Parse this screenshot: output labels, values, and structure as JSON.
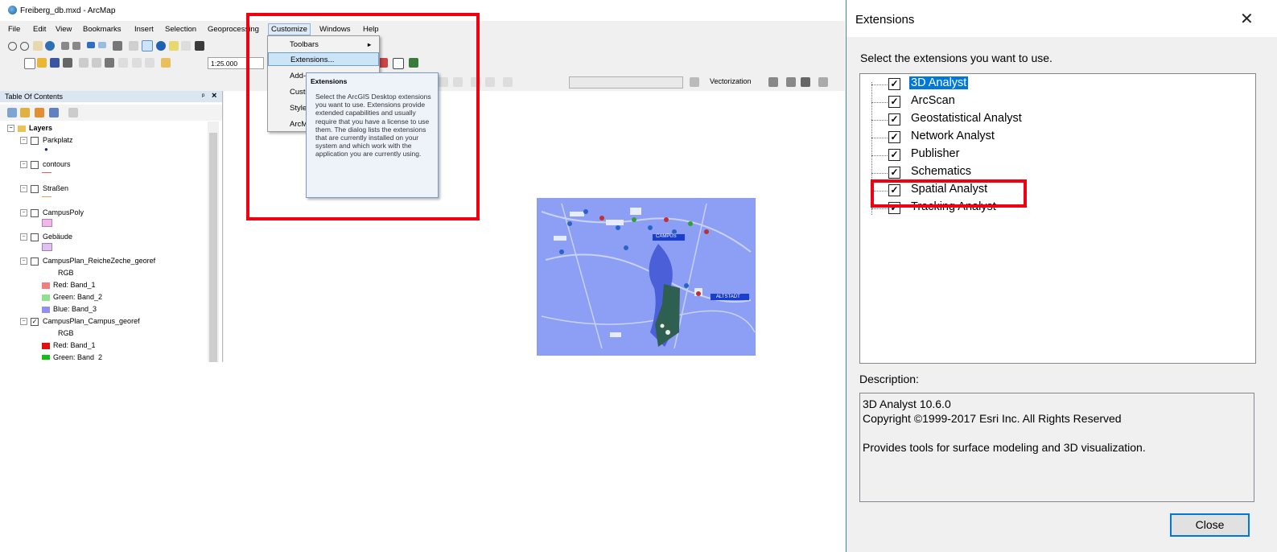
{
  "arcmap": {
    "title": "Freiberg_db.mxd - ArcMap",
    "menu": [
      "File",
      "Edit",
      "View",
      "Bookmarks",
      "Insert",
      "Selection",
      "Geoprocessing",
      "Customize",
      "Windows",
      "Help"
    ],
    "scale_value": "1:25.000",
    "vectorization_label": "Vectorization",
    "toc": {
      "title": "Table Of Contents",
      "layers_group": "Layers",
      "items": [
        {
          "name": "Parkplatz",
          "checked": false
        },
        {
          "name": "contours",
          "checked": false
        },
        {
          "name": "Straßen",
          "checked": false
        },
        {
          "name": "CampusPoly",
          "checked": false
        },
        {
          "name": "Gebäude",
          "checked": false
        },
        {
          "name": "CampusPlan_ReicheZeche_georef",
          "checked": false
        },
        {
          "name": "CampusPlan_Campus_georef",
          "checked": true
        }
      ],
      "rgb_label": "RGB",
      "band_rows_1": [
        "Red:   Band_1",
        "Green: Band_2",
        "Blue:  Band_3"
      ],
      "band_rows_2": [
        "Red:   Band_1",
        "Green: Band_2"
      ]
    },
    "customize_menu": {
      "items": [
        "Toolbars",
        "Extensions...",
        "Add-",
        "Custo",
        "Style",
        "ArcM"
      ]
    },
    "tooltip": {
      "title": "Extensions",
      "body": "Select the ArcGIS Desktop extensions you want to use. Extensions provide extended capabilities and usually require that you have a license to use them. The dialog lists the extensions that are currently installed on your system and which work with the application you are currently using."
    },
    "map_labels": [
      "CAMPUS",
      "ALTSTADT"
    ]
  },
  "dialog": {
    "title": "Extensions",
    "prompt": "Select the extensions you want to use.",
    "extensions": [
      {
        "label": "3D Analyst",
        "checked": true,
        "selected": true
      },
      {
        "label": "ArcScan",
        "checked": true,
        "selected": false
      },
      {
        "label": "Geostatistical Analyst",
        "checked": true,
        "selected": false
      },
      {
        "label": "Network Analyst",
        "checked": true,
        "selected": false
      },
      {
        "label": "Publisher",
        "checked": true,
        "selected": false
      },
      {
        "label": "Schematics",
        "checked": true,
        "selected": false
      },
      {
        "label": "Spatial Analyst",
        "checked": true,
        "selected": false
      },
      {
        "label": "Tracking Analyst",
        "checked": true,
        "selected": false
      }
    ],
    "description_label": "Description:",
    "description": {
      "line1": "3D Analyst 10.6.0",
      "line2": "Copyright ©1999-2017 Esri Inc. All Rights Reserved",
      "line3": "Provides tools for surface modeling and 3D visualization."
    },
    "close_label": "Close"
  },
  "colors": {
    "highlight_red": "#f00010",
    "selection_blue": "#0078d7",
    "map_blue": "#8d9ff5"
  }
}
